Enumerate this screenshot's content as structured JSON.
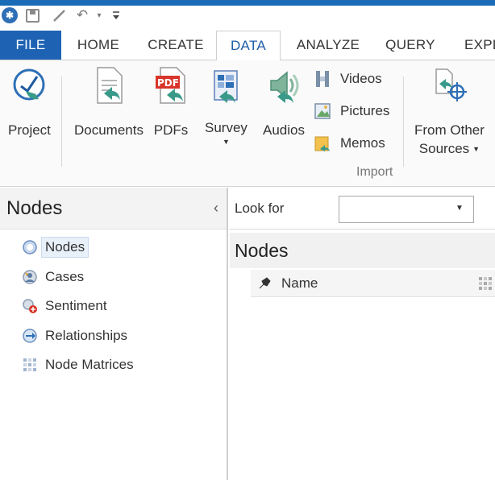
{
  "qat": {
    "icons": [
      "app-logo-icon",
      "save-icon",
      "pen-icon",
      "undo-icon",
      "dropdown-caret-icon",
      "customize-icon"
    ],
    "undo_glyph": "↶",
    "caret_glyph": "▾",
    "more_glyph": "₹"
  },
  "tabs": [
    {
      "label": "FILE"
    },
    {
      "label": "HOME"
    },
    {
      "label": "CREATE"
    },
    {
      "label": "DATA"
    },
    {
      "label": "ANALYZE"
    },
    {
      "label": "QUERY"
    },
    {
      "label": "EXPL"
    }
  ],
  "active_tab": "DATA",
  "ribbon": {
    "project": "Project",
    "documents": "Documents",
    "pdfs": "PDFs",
    "survey": "Survey",
    "audios": "Audios",
    "videos": "Videos",
    "pictures": "Pictures",
    "memos": "Memos",
    "from_other_line1": "From Other",
    "from_other_line2": "Sources",
    "group_label": "Import"
  },
  "left_panel": {
    "title": "Nodes",
    "collapse_glyph": "‹",
    "items": [
      {
        "label": "Nodes",
        "icon": "node-icon",
        "selected": true
      },
      {
        "label": "Cases",
        "icon": "case-icon"
      },
      {
        "label": "Sentiment",
        "icon": "sentiment-icon"
      },
      {
        "label": "Relationships",
        "icon": "relationship-icon"
      },
      {
        "label": "Node Matrices",
        "icon": "node-matrix-icon"
      }
    ]
  },
  "find_bar": {
    "label": "Look for",
    "value": ""
  },
  "list": {
    "title": "Nodes",
    "columns": [
      {
        "label": "Name"
      }
    ]
  },
  "colors": {
    "accent": "#1e63b3",
    "active_tab_text": "#1e5fa8",
    "pdf_red": "#d9352a",
    "arrow_teal": "#3a9a8a"
  }
}
